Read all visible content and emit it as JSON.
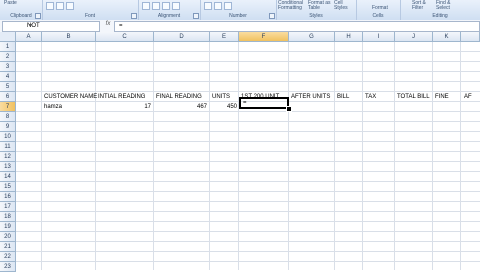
{
  "ribbon": {
    "groups": [
      "Clipboard",
      "Font",
      "Alignment",
      "Number",
      "Styles",
      "Cells",
      "Editing"
    ],
    "paste_label": "Paste",
    "cond_format_label": "Conditional Formatting",
    "format_table_label": "Format as Table",
    "cell_styles_label": "Cell Styles",
    "format_label": "Format",
    "sort_filter_label": "Sort & Filter",
    "find_select_label": "Find & Select"
  },
  "formula_bar": {
    "name_box": "NOT",
    "fx": "fx",
    "formula": "="
  },
  "columns": [
    "A",
    "B",
    "C",
    "D",
    "E",
    "F",
    "G",
    "H",
    "I",
    "J",
    "K"
  ],
  "rows": [
    "1",
    "2",
    "3",
    "4",
    "5",
    "6",
    "7",
    "8",
    "9",
    "10",
    "11",
    "12",
    "13",
    "14",
    "15",
    "16",
    "17",
    "18",
    "19",
    "20",
    "21",
    "22",
    "23"
  ],
  "headers_row6": {
    "customer_name": "CUSTOMER NAME",
    "initial_reading": "INTIAL READING",
    "final_reading": "FINAL READING",
    "units": "UNITS",
    "first_200_unit": "1ST 200 UNIT",
    "after_units": "AFTER UNITS",
    "bill": "BILL",
    "tax": "TAX",
    "total_bill": "TOTAL BILL",
    "fine": "FINE",
    "af": "AF"
  },
  "row7": {
    "customer_name": "hamza",
    "initial_reading": "17",
    "final_reading": "467",
    "units": "450",
    "active_cell_text": "="
  },
  "colors": {
    "ribbon_bg": "#cfdff2",
    "header_bg": "#dce6f3",
    "selected_header": "#f1c15f",
    "grid_line": "#d9dfe8"
  }
}
